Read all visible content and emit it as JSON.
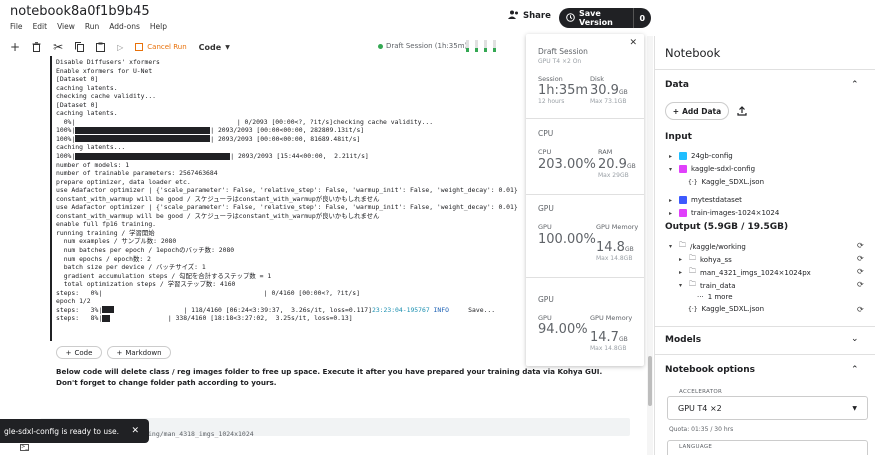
{
  "header": {
    "title": "notebook8a0f1b9b45",
    "menu": [
      "File",
      "Edit",
      "View",
      "Run",
      "Add-ons",
      "Help"
    ],
    "share_label": "Share",
    "save_label": "Save Version",
    "save_count": "0"
  },
  "toolbar": {
    "cancel_label": "Cancel Run",
    "code_label": "Code",
    "session_label": "Draft Session (1h:35m)"
  },
  "output": {
    "lines": [
      "Disable Diffusers' xformers",
      "Enable xformers for U-Net",
      "[Dataset 0]",
      "caching latents.",
      "checking cache validity...",
      "[Dataset 0]",
      "caching latents.",
      "  0%|                                          | 0/2093 [00:00<?, ?it/s]checking cache validity...",
      "100%|##BAR30##| 2093/2093 [00:00<00:00, 282809.13it/s]",
      "100%|##BAR30##| 2093/2093 [00:00<00:00, 81689.48it/s]",
      "caching latents...",
      "100%|##BAR34##| 2093/2093 [15:44<00:00,  2.21it/s]",
      "number of models: 1",
      "number of trainable parameters: 2567463684",
      "prepare optimizer, data loader etc.",
      "use Adafactor optimizer | {'scale_parameter': False, 'relative_step': False, 'warmup_init': False, 'weight_decay': 0.01}",
      "constant_with_warmup will be good / スケジューラはconstant_with_warmupが良いかもしれません",
      "use Adafactor optimizer | {'scale_parameter': False, 'relative_step': False, 'warmup_init': False, 'weight_decay': 0.01}",
      "constant_with_warmup will be good / スケジューラはconstant_with_warmupが良いかもしれません",
      "enable full fp16 training.",
      "running training / 学習開始",
      "  num examples / サンプル数: 2080",
      "  num batches per epoch / 1epochのバッチ数: 2080",
      "  num epochs / epoch数: 2",
      "  batch size per device / バッチサイズ: 1",
      "  gradient accumulation steps / 勾配を合計するステップ数 = 1",
      "  total optimization steps / 学習ステップ数: 4160",
      "steps:   0%|                                          | 0/4160 [00:00<?, ?it/s]",
      "epoch 1/2",
      "steps:   3%|##BAR2##                  | 118/4160 [06:24<3:39:37,  3.26s/it, loss=0.117]##CYAN##23:23:04-195767##END## ##BLUE##INFO##END##     Save...",
      "steps:   8%|##BAR3##               | 338/4160 [18:18<3:27:02,  3.25s/it, loss=0.13]"
    ]
  },
  "cell_actions": {
    "add_code": "Code",
    "add_markdown": "Markdown"
  },
  "markdown_text": "Below code will delete class / reg images folder to free up space. Execute it after you have prepared your training data via Kohya GUI. Don't forget to change folder path according to yours.",
  "next_cell_text": "ing/man_4318_imgs_1024x1024",
  "toast": {
    "message": "gle-sdxl-config is ready to use.",
    "close": "✕"
  },
  "session_popup": {
    "title": "Draft Session",
    "subtitle": "GPU T4 ×2 On",
    "session_label": "Session",
    "session_value": "1h:35m",
    "session_sub": "12 hours",
    "disk_label": "Disk",
    "disk_value": "30.9",
    "disk_unit": "GB",
    "disk_sub": "Max 73.1GB",
    "cpu_title": "CPU",
    "cpu_label": "CPU",
    "cpu_value": "203.00%",
    "ram_label": "RAM",
    "ram_value": "20.9",
    "ram_unit": "GB",
    "ram_sub": "Max 29GB",
    "gpu1_title": "GPU",
    "gpu1_label": "GPU",
    "gpu1_value": "100.00%",
    "gpu1_mem_label": "GPU Memory",
    "gpu1_mem_value": "14.8",
    "gpu1_mem_unit": "GB",
    "gpu1_mem_sub": "Max 14.8GB",
    "gpu2_title": "GPU",
    "gpu2_label": "GPU",
    "gpu2_value": "94.00%",
    "gpu2_mem_label": "GPU Memory",
    "gpu2_mem_value": "14.7",
    "gpu2_mem_unit": "GB",
    "gpu2_mem_sub": "Max 14.8GB"
  },
  "panel": {
    "title": "Notebook",
    "data_header": "Data",
    "add_data": "Add Data",
    "input_header": "Input",
    "inputs": [
      "24gb-config",
      "kaggle-sdxl-config",
      "Kaggle_SDXL.json",
      "mytestdataset",
      "train-images-1024×1024"
    ],
    "output_header": "Output (5.9GB / 19.5GB)",
    "outputs": [
      "/kaggle/working",
      "kohya_ss",
      "man_4321_imgs_1024×1024px",
      "train_data",
      "1 more",
      "Kaggle_SDXL.json"
    ],
    "models_header": "Models",
    "options_header": "Notebook options",
    "accelerator_label": "ACCELERATOR",
    "accelerator_value": "GPU T4 ×2",
    "quota": "Quota: 01:35 / 30 hrs",
    "language_label": "LANGUAGE"
  },
  "colors": {
    "input_icon_1": "#20beff",
    "input_icon_2": "#e040fb",
    "input_icon_3": "#3d5afe",
    "input_icon_4": "#e040fb",
    "success": "#34a853",
    "cancel": "#e8710a"
  }
}
